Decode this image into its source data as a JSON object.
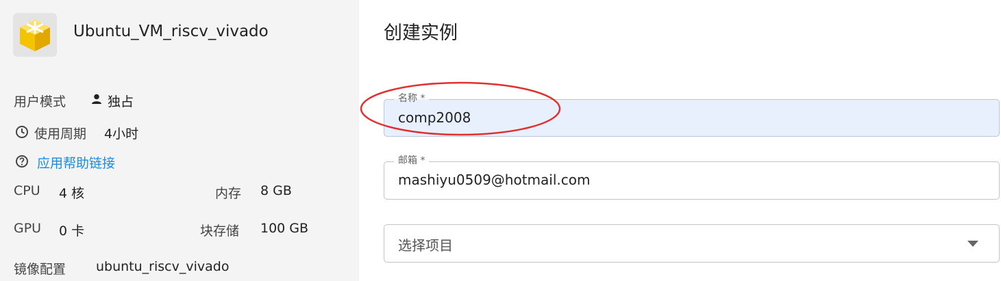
{
  "app": {
    "name": "Ubuntu_VM_riscv_vivado",
    "icon": "cube-app-icon"
  },
  "details": {
    "user_mode_label": "用户模式",
    "user_mode_value": "独占",
    "period_label": "使用周期",
    "period_value": "4小时",
    "help_link": "应用帮助链接",
    "cpu_label": "CPU",
    "cpu_value": "4 核",
    "memory_label": "内存",
    "memory_value": "8 GB",
    "gpu_label": "GPU",
    "gpu_value": "0 卡",
    "storage_label": "块存储",
    "storage_value": "100 GB",
    "image_label": "镜像配置",
    "image_value": "ubuntu_riscv_vivado"
  },
  "form": {
    "title": "创建实例",
    "name_label": "名称 *",
    "name_value": "comp2008",
    "email_label": "邮箱 *",
    "email_value": "mashiyu0509@hotmail.com",
    "project_placeholder": "选择项目"
  },
  "colors": {
    "link": "#1a8ce0",
    "annotation": "#e03030",
    "filled_field": "#e8f0fe"
  }
}
